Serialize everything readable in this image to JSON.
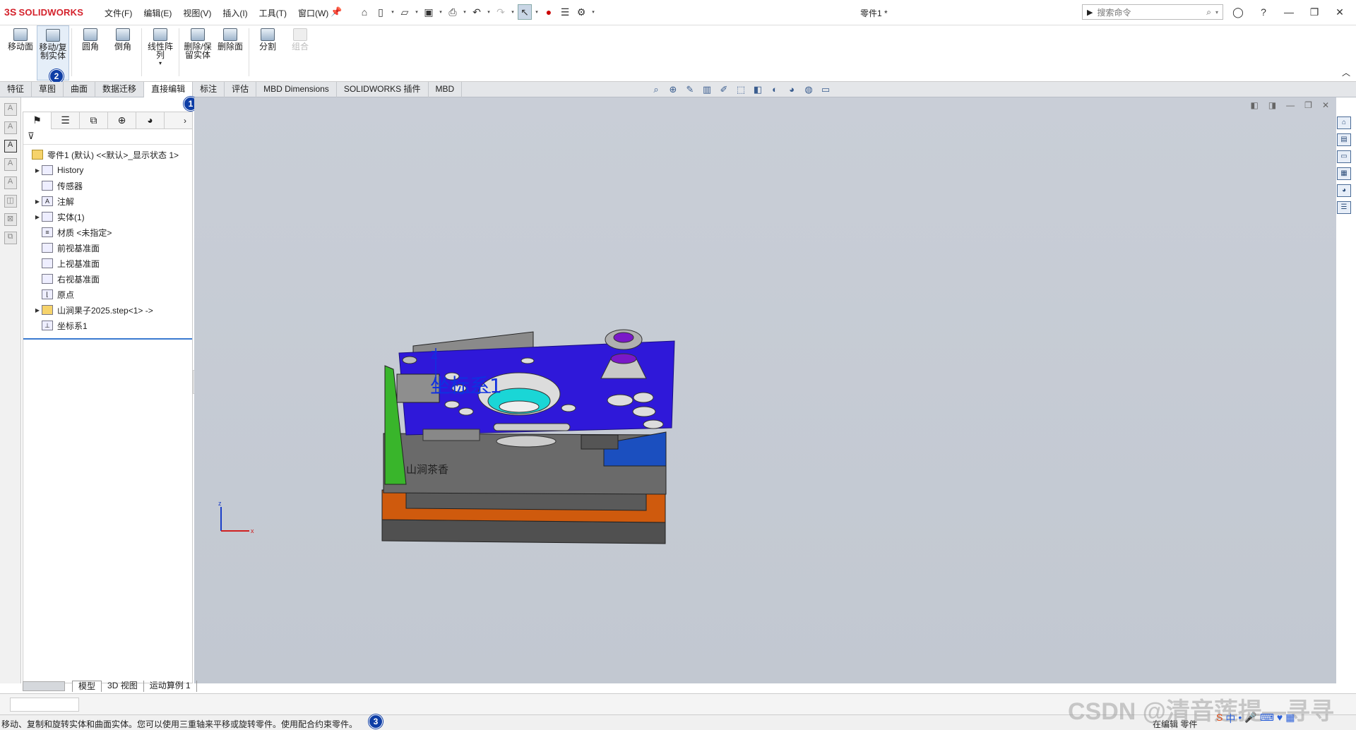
{
  "app": {
    "logo": {
      "mark": "3S",
      "name": "SOLIDWORKS"
    },
    "document_title": "零件1 *"
  },
  "menus": [
    "文件(F)",
    "编辑(E)",
    "视图(V)",
    "插入(I)",
    "工具(T)",
    "窗口(W)"
  ],
  "search": {
    "placeholder": "搜索命令"
  },
  "ribbon": {
    "tools": [
      {
        "label": "移动面",
        "icon": "move-face-icon"
      },
      {
        "label": "移动/复制实体",
        "icon": "move-copy-body-icon",
        "active": true
      },
      {
        "label": "圆角",
        "icon": "fillet-icon"
      },
      {
        "label": "倒角",
        "icon": "chamfer-icon"
      },
      {
        "label": "线性阵列",
        "icon": "linear-pattern-icon"
      },
      {
        "label": "删除/保留实体",
        "icon": "delete-keep-body-icon"
      },
      {
        "label": "删除面",
        "icon": "delete-face-icon"
      },
      {
        "label": "分割",
        "icon": "split-icon"
      },
      {
        "label": "组合",
        "icon": "combine-icon",
        "disabled": true
      }
    ]
  },
  "command_tabs": [
    "特征",
    "草图",
    "曲面",
    "数据迁移",
    "直接编辑",
    "标注",
    "评估",
    "MBD Dimensions",
    "SOLIDWORKS 插件",
    "MBD"
  ],
  "active_tab": "直接编辑",
  "badges": {
    "one": "1",
    "two": "2",
    "three": "3"
  },
  "feature_tree": {
    "root": "零件1 (默认) <<默认>_显示状态 1>",
    "items": [
      {
        "label": "History",
        "expandable": true,
        "icon": "history-icon"
      },
      {
        "label": "传感器",
        "expandable": false,
        "icon": "sensor-icon"
      },
      {
        "label": "注解",
        "expandable": true,
        "icon": "annotation-icon"
      },
      {
        "label": "实体(1)",
        "expandable": true,
        "icon": "solid-bodies-icon"
      },
      {
        "label": "材质 <未指定>",
        "expandable": false,
        "icon": "material-icon"
      },
      {
        "label": "前视基准面",
        "expandable": false,
        "icon": "plane-icon"
      },
      {
        "label": "上视基准面",
        "expandable": false,
        "icon": "plane-icon"
      },
      {
        "label": "右视基准面",
        "expandable": false,
        "icon": "plane-icon"
      },
      {
        "label": "原点",
        "expandable": false,
        "icon": "origin-icon"
      },
      {
        "label": "山涧果子2025.step<1> ->",
        "expandable": true,
        "icon": "part-icon"
      },
      {
        "label": "坐标系1",
        "expandable": false,
        "icon": "coordinate-system-icon"
      }
    ]
  },
  "model": {
    "engraving": "山涧茶香",
    "coord_label": "坐标系1",
    "axis_z": "Z",
    "triad_z": "z",
    "triad_x": "x"
  },
  "bottom_tabs": [
    "模型",
    "3D 视图",
    "运动算例 1"
  ],
  "status": {
    "message": "移动、复制和旋转实体和曲面实体。您可以使用三重轴来平移或旋转零件。使用配合约束零件。",
    "mode": "在编辑 零件"
  },
  "watermark": "CSDN @清音莲提—寻寻",
  "colors": {
    "model_top": "#2f18d9",
    "accent": "#0e3ea6",
    "orange": "#d0580a",
    "green": "#38b52a"
  }
}
